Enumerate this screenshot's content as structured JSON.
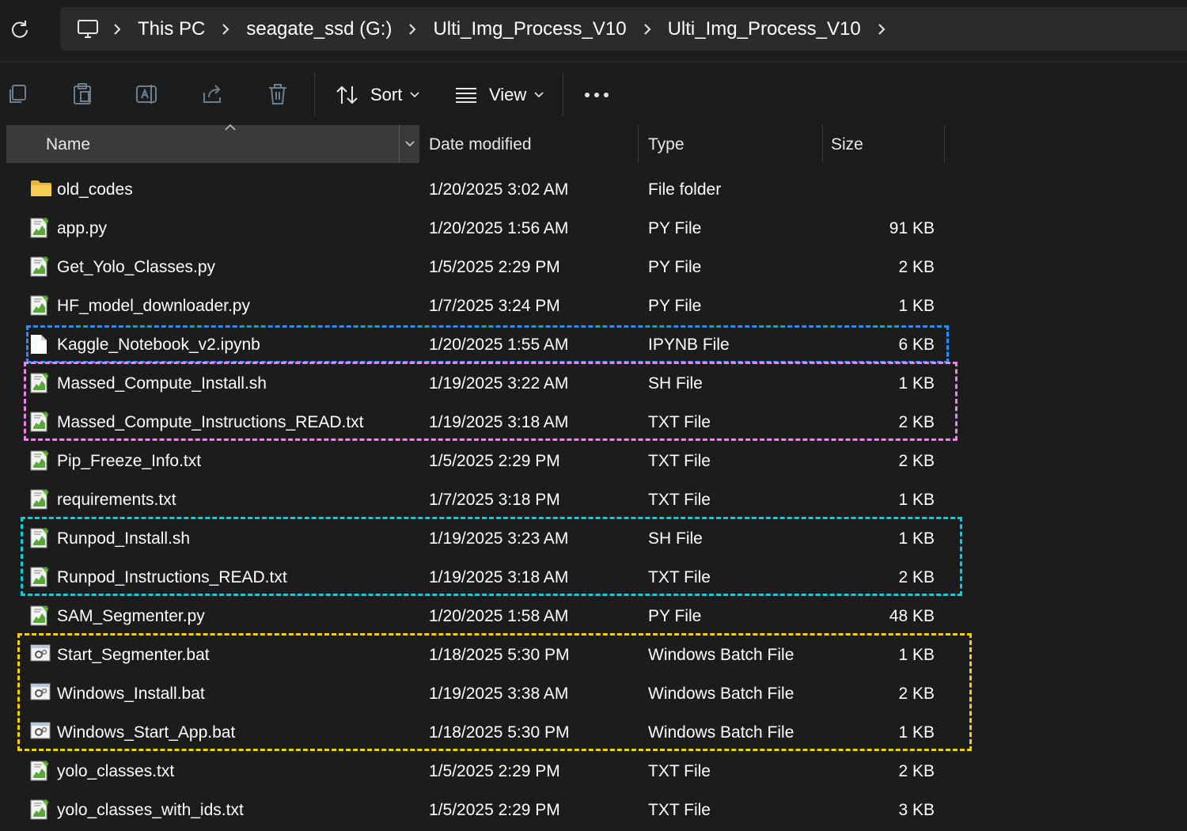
{
  "breadcrumb": {
    "items": [
      "This PC",
      "seagate_ssd (G:)",
      "Ulti_Img_Process_V10",
      "Ulti_Img_Process_V10"
    ]
  },
  "toolbar": {
    "sort_label": "Sort",
    "view_label": "View"
  },
  "columns": {
    "name": "Name",
    "date": "Date modified",
    "type": "Type",
    "size": "Size"
  },
  "files": [
    {
      "name": "old_codes",
      "date": "1/20/2025 3:02 AM",
      "type": "File folder",
      "size": "",
      "icon": "folder-icon"
    },
    {
      "name": "app.py",
      "date": "1/20/2025 1:56 AM",
      "type": "PY File",
      "size": "91 KB",
      "icon": "script-file-icon"
    },
    {
      "name": "Get_Yolo_Classes.py",
      "date": "1/5/2025 2:29 PM",
      "type": "PY File",
      "size": "2 KB",
      "icon": "script-file-icon"
    },
    {
      "name": "HF_model_downloader.py",
      "date": "1/7/2025 3:24 PM",
      "type": "PY File",
      "size": "1 KB",
      "icon": "script-file-icon"
    },
    {
      "name": "Kaggle_Notebook_v2.ipynb",
      "date": "1/20/2025 1:55 AM",
      "type": "IPYNB File",
      "size": "6 KB",
      "icon": "blank-file-icon"
    },
    {
      "name": "Massed_Compute_Install.sh",
      "date": "1/19/2025 3:22 AM",
      "type": "SH File",
      "size": "1 KB",
      "icon": "script-file-icon"
    },
    {
      "name": "Massed_Compute_Instructions_READ.txt",
      "date": "1/19/2025 3:18 AM",
      "type": "TXT File",
      "size": "2 KB",
      "icon": "script-file-icon"
    },
    {
      "name": "Pip_Freeze_Info.txt",
      "date": "1/5/2025 2:29 PM",
      "type": "TXT File",
      "size": "2 KB",
      "icon": "script-file-icon"
    },
    {
      "name": "requirements.txt",
      "date": "1/7/2025 3:18 PM",
      "type": "TXT File",
      "size": "1 KB",
      "icon": "script-file-icon"
    },
    {
      "name": "Runpod_Install.sh",
      "date": "1/19/2025 3:23 AM",
      "type": "SH File",
      "size": "1 KB",
      "icon": "script-file-icon"
    },
    {
      "name": "Runpod_Instructions_READ.txt",
      "date": "1/19/2025 3:18 AM",
      "type": "TXT File",
      "size": "2 KB",
      "icon": "script-file-icon"
    },
    {
      "name": "SAM_Segmenter.py",
      "date": "1/20/2025 1:58 AM",
      "type": "PY File",
      "size": "48 KB",
      "icon": "script-file-icon"
    },
    {
      "name": "Start_Segmenter.bat",
      "date": "1/18/2025 5:30 PM",
      "type": "Windows Batch File",
      "size": "1 KB",
      "icon": "batch-file-icon"
    },
    {
      "name": "Windows_Install.bat",
      "date": "1/19/2025 3:38 AM",
      "type": "Windows Batch File",
      "size": "2 KB",
      "icon": "batch-file-icon"
    },
    {
      "name": "Windows_Start_App.bat",
      "date": "1/18/2025 5:30 PM",
      "type": "Windows Batch File",
      "size": "1 KB",
      "icon": "batch-file-icon"
    },
    {
      "name": "yolo_classes.txt",
      "date": "1/5/2025 2:29 PM",
      "type": "TXT File",
      "size": "2 KB",
      "icon": "script-file-icon"
    },
    {
      "name": "yolo_classes_with_ids.txt",
      "date": "1/5/2025 2:29 PM",
      "type": "TXT File",
      "size": "3 KB",
      "icon": "script-file-icon"
    }
  ],
  "highlights": [
    {
      "color": "#1e90ff",
      "rows": [
        4
      ]
    },
    {
      "color": "#ee82ee",
      "rows": [
        5,
        6
      ]
    },
    {
      "color": "#00d0e0",
      "rows": [
        9,
        10
      ]
    },
    {
      "color": "#f5d000",
      "rows": [
        12,
        13,
        14
      ]
    }
  ]
}
